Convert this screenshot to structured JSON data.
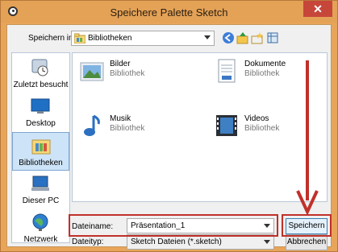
{
  "window": {
    "title": "Speichere Palette Sketch",
    "close_glyph": "✕"
  },
  "toolbar": {
    "save_in_label": "Speichern in:",
    "location": "Bibliotheken",
    "icons": [
      "back-icon",
      "up-folder-icon",
      "new-folder-icon",
      "view-menu-icon"
    ]
  },
  "places": [
    {
      "label": "Zuletzt besucht",
      "icon": "recent-places-icon",
      "selected": false
    },
    {
      "label": "Desktop",
      "icon": "desktop-icon",
      "selected": false
    },
    {
      "label": "Bibliotheken",
      "icon": "libraries-icon",
      "selected": true
    },
    {
      "label": "Dieser PC",
      "icon": "computer-icon",
      "selected": false
    },
    {
      "label": "Netzwerk",
      "icon": "network-icon",
      "selected": false
    }
  ],
  "files": [
    {
      "name": "Bilder",
      "type": "Bibliothek",
      "icon": "pictures-library-icon"
    },
    {
      "name": "Dokumente",
      "type": "Bibliothek",
      "icon": "documents-library-icon"
    },
    {
      "name": "Musik",
      "type": "Bibliothek",
      "icon": "music-library-icon"
    },
    {
      "name": "Videos",
      "type": "Bibliothek",
      "icon": "videos-library-icon"
    }
  ],
  "form": {
    "filename_label": "Dateiname:",
    "filename_value": "Präsentation_1",
    "filetype_label": "Dateityp:",
    "filetype_value": "Sketch Dateien (*.sketch)"
  },
  "buttons": {
    "save": "Speichern",
    "cancel": "Abbrechen"
  },
  "colors": {
    "titlebar": "#e4a257",
    "annotation": "#c0302a",
    "selection": "#cde3f7"
  }
}
